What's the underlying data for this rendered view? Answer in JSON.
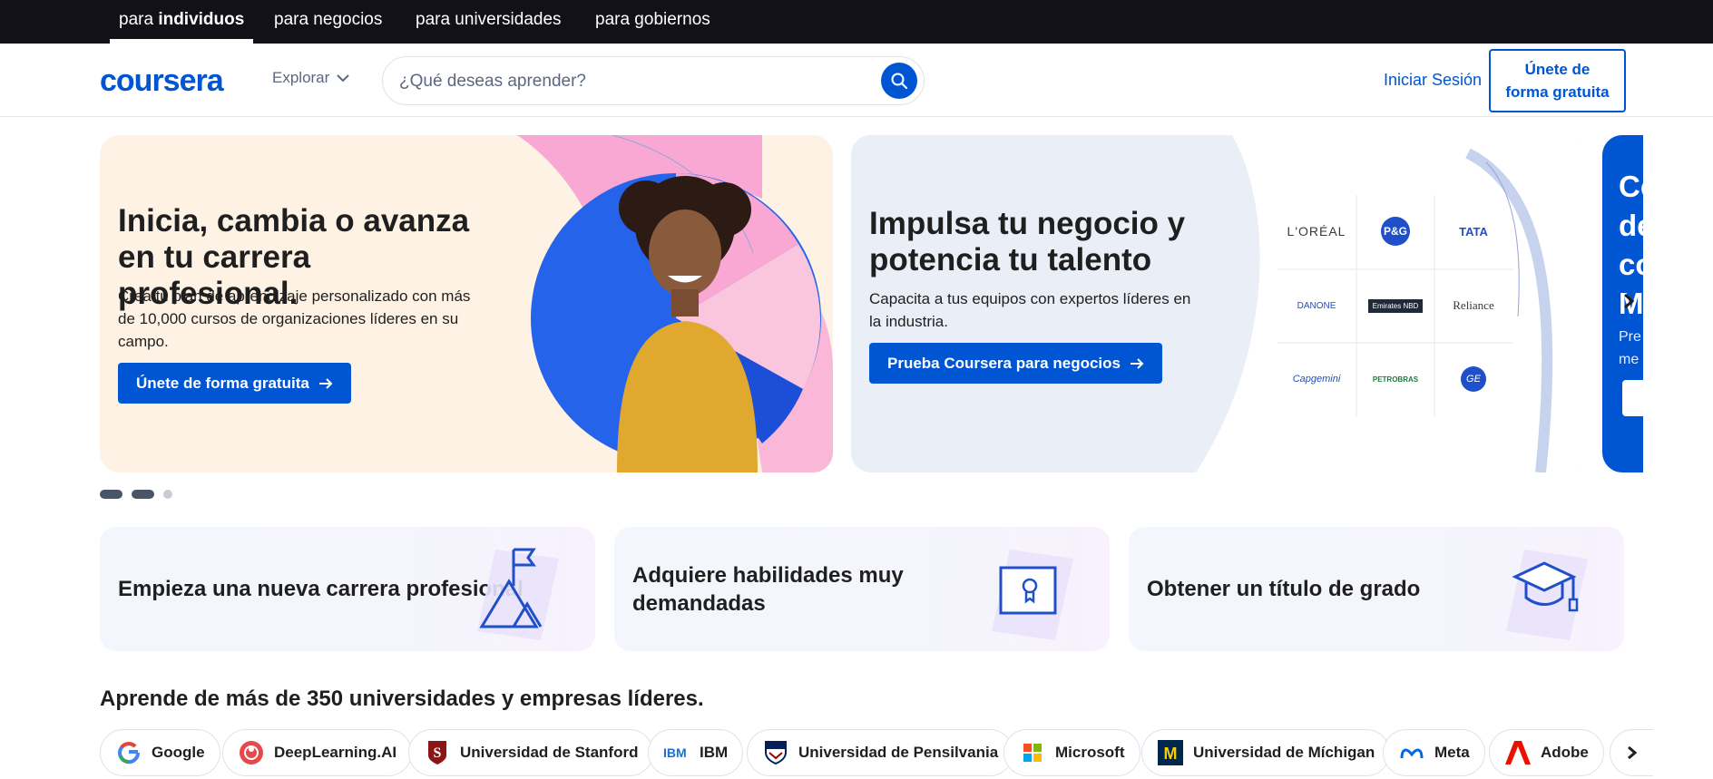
{
  "audience_tabs": [
    {
      "prefix": "para ",
      "emphasis": "individuos"
    },
    {
      "label": "para negocios"
    },
    {
      "label": "para universidades"
    },
    {
      "label": "para gobiernos"
    }
  ],
  "header": {
    "logo": "coursera",
    "explore": "Explorar",
    "search_placeholder": "¿Qué deseas aprender?",
    "login": "Iniciar Sesión",
    "join": "Únete de\nforma gratuita"
  },
  "carousel": {
    "slide1": {
      "title": "Inicia, cambia o avanza en tu carrera profesional.",
      "text": "Crea tu plan de aprendizaje personalizado con más de 10,000 cursos de organizaciones líderes en su campo.",
      "button": "Únete de forma gratuita"
    },
    "slide2": {
      "title": "Impulsa tu negocio y potencia tu talento",
      "text": "Capacita a tus equipos con expertos líderes en la industria.",
      "button": "Prueba Coursera para negocios",
      "logos": [
        "L'ORÉAL",
        "P&G",
        "TATA",
        "DANONE",
        "Emirates NBD",
        "Reliance",
        "Capgemini",
        "PETROBRAS",
        "GE"
      ]
    },
    "slide3": {
      "title_lines": [
        "Co",
        "de",
        "co",
        "M"
      ],
      "text_lines": [
        "Pre",
        "me"
      ]
    }
  },
  "goals": [
    {
      "label": "Empieza una nueva carrera profesional"
    },
    {
      "label": "Adquiere habilidades muy demandadas"
    },
    {
      "label": "Obtener un título de grado"
    }
  ],
  "partners": {
    "title": "Aprende de más de 350 universidades y empresas líderes.",
    "items": [
      {
        "name": "Google"
      },
      {
        "name": "DeepLearning.AI"
      },
      {
        "name": "Universidad de Stanford"
      },
      {
        "name": "IBM"
      },
      {
        "name": "Universidad de Pensilvania"
      },
      {
        "name": "Microsoft"
      },
      {
        "name": "Universidad de Míchigan"
      },
      {
        "name": "Meta"
      },
      {
        "name": "Adobe"
      }
    ]
  },
  "colors": {
    "brand": "#0056d2",
    "topbar": "#111117",
    "hero1_bg": "#fdf2e4",
    "hero2_bg": "#e9eef7"
  }
}
